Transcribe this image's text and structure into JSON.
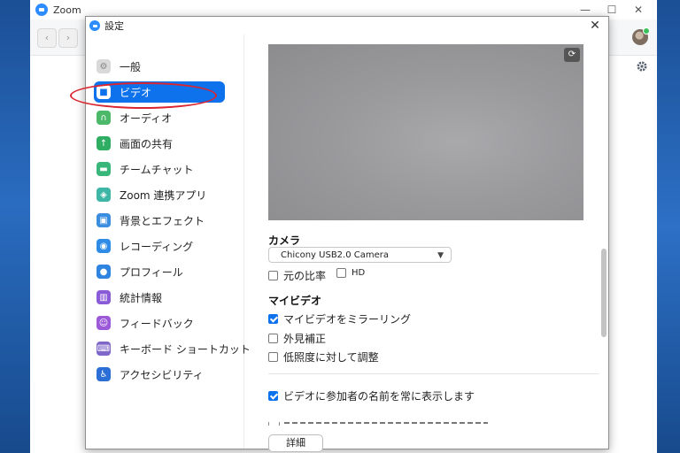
{
  "app": {
    "title": "Zoom"
  },
  "window_controls": {
    "minimize": "—",
    "maximize": "☐",
    "close": "✕"
  },
  "toolbar": {
    "back": "‹",
    "forward": "›"
  },
  "dialog": {
    "title": "設定",
    "close": "✕"
  },
  "sidebar": {
    "active_index": 1,
    "items": [
      {
        "label": "一般",
        "icon": "gear-icon",
        "color": "#d9d9d9",
        "glyph": "⚙"
      },
      {
        "label": "ビデオ",
        "icon": "video-camera-icon",
        "color": "#ffffff",
        "glyph": "■"
      },
      {
        "label": "オーディオ",
        "icon": "headphones-icon",
        "color": "#4cb86a",
        "glyph": "∩"
      },
      {
        "label": "画面の共有",
        "icon": "share-screen-icon",
        "color": "#2fae63",
        "glyph": "↑"
      },
      {
        "label": "チームチャット",
        "icon": "chat-icon",
        "color": "#39b67a",
        "glyph": "▬"
      },
      {
        "label": "Zoom 連携アプリ",
        "icon": "apps-icon",
        "color": "#3db6a6",
        "glyph": "◈"
      },
      {
        "label": "背景とエフェクト",
        "icon": "background-icon",
        "color": "#3b8de0",
        "glyph": "▣"
      },
      {
        "label": "レコーディング",
        "icon": "record-icon",
        "color": "#2f8ce6",
        "glyph": "◉"
      },
      {
        "label": "プロフィール",
        "icon": "profile-icon",
        "color": "#2f84e0",
        "glyph": "●"
      },
      {
        "label": "統計情報",
        "icon": "statistics-icon",
        "color": "#8a5bd6",
        "glyph": "▥"
      },
      {
        "label": "フィードバック",
        "icon": "feedback-icon",
        "color": "#9b59d8",
        "glyph": "☺"
      },
      {
        "label": "キーボード ショートカット",
        "icon": "keyboard-icon",
        "color": "#7f67c9",
        "glyph": "⌨"
      },
      {
        "label": "アクセシビリティ",
        "icon": "accessibility-icon",
        "color": "#2b6fd6",
        "glyph": "♿"
      }
    ]
  },
  "camera": {
    "section": "カメラ",
    "selected": "Chicony USB2.0 Camera",
    "original_ratio": {
      "label": "元の比率",
      "checked": false
    },
    "hd": {
      "label": "HD",
      "checked": false
    }
  },
  "my_video": {
    "section": "マイビデオ",
    "mirror": {
      "label": "マイビデオをミラーリング",
      "checked": true
    },
    "touch_up": {
      "label": "外見補正",
      "checked": false
    },
    "low_light": {
      "label": "低照度に対して調整",
      "checked": false
    }
  },
  "always_show_names": {
    "label": "ビデオに参加者の名前を常に表示します",
    "checked": true
  },
  "details_button": "詳細"
}
